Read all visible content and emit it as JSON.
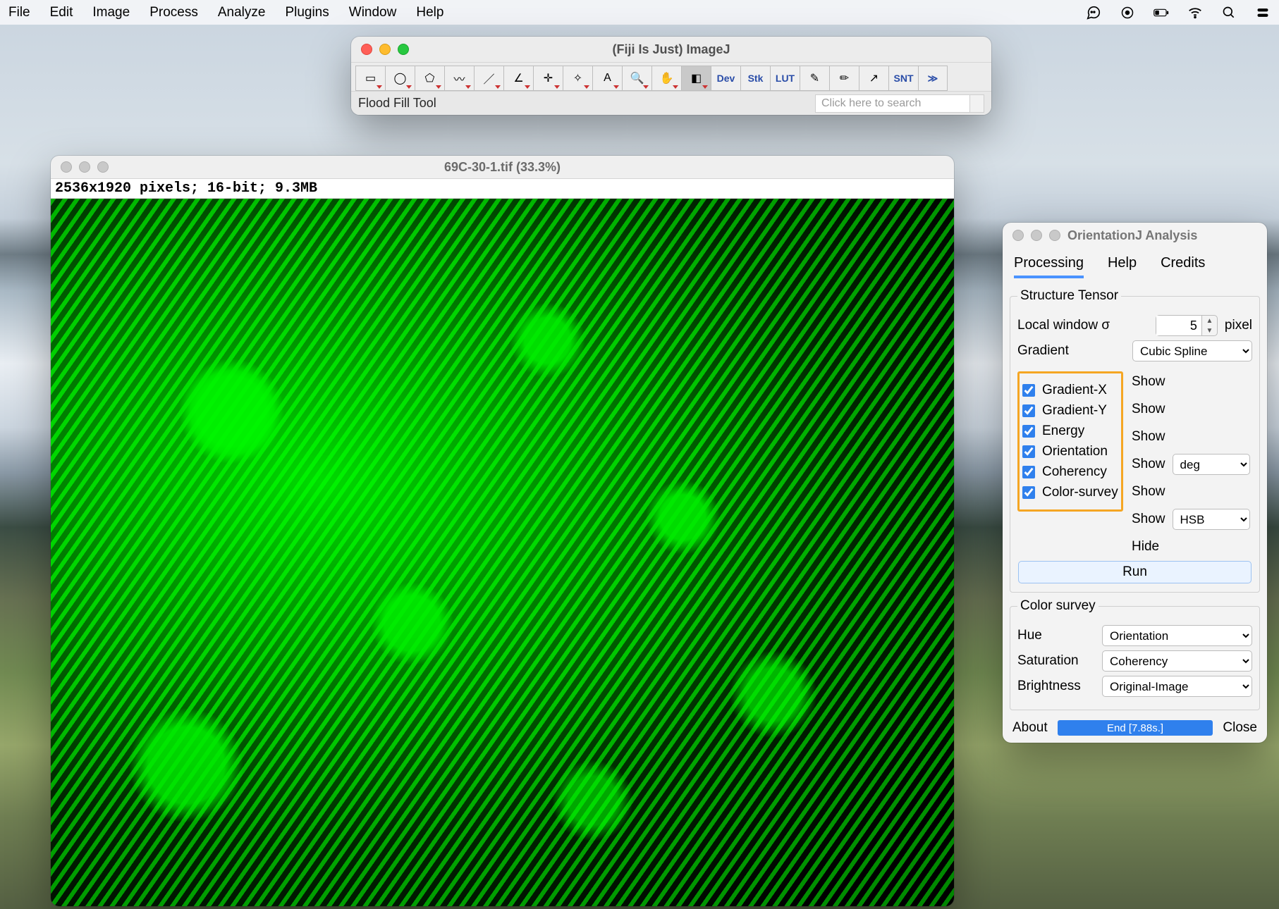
{
  "menubar": {
    "items": [
      "File",
      "Edit",
      "Image",
      "Process",
      "Analyze",
      "Plugins",
      "Window",
      "Help"
    ]
  },
  "imagej": {
    "window_title": "(Fiji Is Just) ImageJ",
    "status_text": "Flood Fill Tool",
    "search_placeholder": "Click here to search",
    "tool_buttons": [
      {
        "name": "rectangle-tool",
        "label": "▭",
        "txt": false
      },
      {
        "name": "oval-tool",
        "label": "◯",
        "txt": false
      },
      {
        "name": "polygon-tool",
        "label": "⬠",
        "txt": false
      },
      {
        "name": "freehand-tool",
        "label": "〰",
        "txt": false
      },
      {
        "name": "line-tool",
        "label": "／",
        "txt": false
      },
      {
        "name": "angle-tool",
        "label": "∠",
        "txt": false
      },
      {
        "name": "point-tool",
        "label": "✛",
        "txt": false
      },
      {
        "name": "wand-tool",
        "label": "✧",
        "txt": false
      },
      {
        "name": "text-tool",
        "label": "A",
        "txt": false
      },
      {
        "name": "zoom-tool",
        "label": "🔍",
        "txt": false
      },
      {
        "name": "hand-tool",
        "label": "✋",
        "txt": false
      },
      {
        "name": "flood-fill-tool",
        "label": "◧",
        "txt": false,
        "selected": true
      },
      {
        "name": "dev-tool",
        "label": "Dev",
        "txt": true
      },
      {
        "name": "stk-tool",
        "label": "Stk",
        "txt": true
      },
      {
        "name": "lut-tool",
        "label": "LUT",
        "txt": true
      },
      {
        "name": "brush-tool",
        "label": "✎",
        "txt": false
      },
      {
        "name": "pencil-tool",
        "label": "✏",
        "txt": false
      },
      {
        "name": "arrow-tool",
        "label": "↗",
        "txt": false
      },
      {
        "name": "snt-tool",
        "label": "SNT",
        "txt": true
      },
      {
        "name": "more-tool",
        "label": "≫",
        "txt": true
      }
    ]
  },
  "image_window": {
    "title": "69C-30-1.tif (33.3%)",
    "info_line": "2536x1920 pixels; 16-bit; 9.3MB"
  },
  "orientationj": {
    "title": "OrientationJ Analysis",
    "tabs": {
      "processing": "Processing",
      "help": "Help",
      "credits": "Credits",
      "active": "processing"
    },
    "structure_tensor": {
      "legend": "Structure Tensor",
      "local_window_label": "Local window σ",
      "local_window_value": "5",
      "local_window_unit": "pixel",
      "gradient_label": "Gradient",
      "gradient_value": "Cubic Spline",
      "checks": [
        {
          "name": "gradient-x",
          "label": "Gradient-X",
          "checked": true,
          "show": "Show"
        },
        {
          "name": "gradient-y",
          "label": "Gradient-Y",
          "checked": true,
          "show": "Show"
        },
        {
          "name": "energy",
          "label": "Energy",
          "checked": true,
          "show": "Show"
        },
        {
          "name": "orientation",
          "label": "Orientation",
          "checked": true,
          "show": "Show",
          "extra_select": "deg"
        },
        {
          "name": "coherency",
          "label": "Coherency",
          "checked": true,
          "show": "Show"
        },
        {
          "name": "color-survey",
          "label": "Color-survey",
          "checked": true,
          "show": "Show",
          "extra_select": "HSB"
        }
      ],
      "hide_label": "Hide",
      "run_label": "Run"
    },
    "color_survey": {
      "legend": "Color survey",
      "hue_label": "Hue",
      "hue_value": "Orientation",
      "sat_label": "Saturation",
      "sat_value": "Coherency",
      "bri_label": "Brightness",
      "bri_value": "Original-Image"
    },
    "bottom": {
      "about": "About",
      "progress": "End [7.88s.]",
      "close": "Close"
    }
  }
}
